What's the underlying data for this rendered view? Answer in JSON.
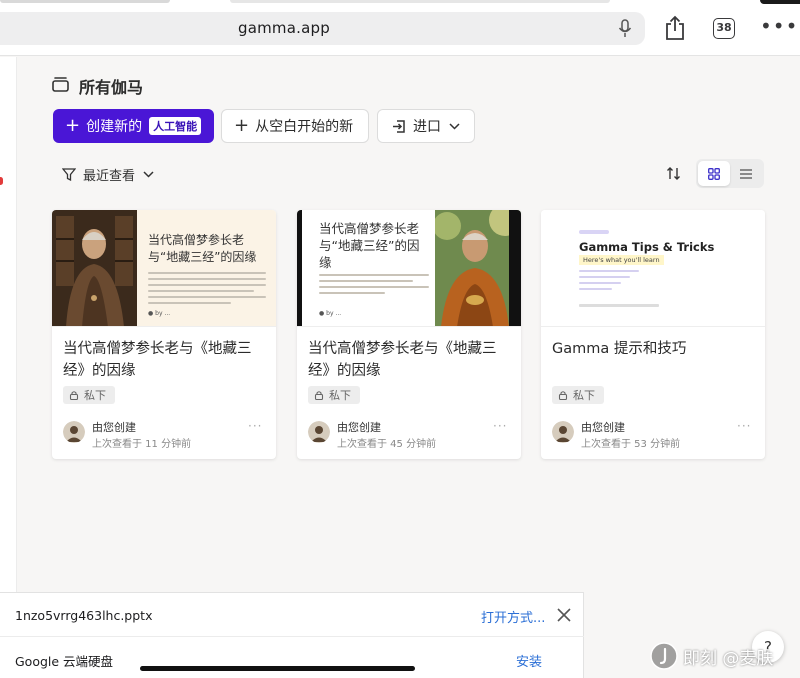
{
  "browser": {
    "url": "gamma.app",
    "tab_count": "38"
  },
  "header": {
    "title": "所有伽马"
  },
  "toolbar": {
    "create_label": "创建新的",
    "ai_badge": "人工智能",
    "blank_label": "从空白开始的新",
    "import_label": "进口"
  },
  "filter": {
    "label": "最近查看"
  },
  "cards": [
    {
      "title": "当代高僧梦参长老与《地藏三经》的因缘",
      "thumb_title": "当代高僧梦参长老与“地藏三经”的因缘",
      "visibility": "私下",
      "creator": "由您创建",
      "last_viewed": "上次查看于 11 分钟前"
    },
    {
      "title": "当代高僧梦参长老与《地藏三经》的因缘",
      "thumb_title": "当代高僧梦参长老与“地藏三经”的因缘",
      "visibility": "私下",
      "creator": "由您创建",
      "last_viewed": "上次查看于 45 分钟前"
    },
    {
      "title": "Gamma 提示和技巧",
      "thumb_title": "Gamma Tips & Tricks",
      "thumb_subtitle": "Here's what you'll learn",
      "visibility": "私下",
      "creator": "由您创建",
      "last_viewed": "上次查看于 53 分钟前"
    }
  ],
  "download": {
    "filename": "1nzo5vrrg463lhc.pptx",
    "open_with": "打开方式...",
    "app_name": "Google 云端硬盘",
    "install": "安装"
  },
  "help": "?",
  "watermark": "即刻 @麦肤",
  "colors": {
    "accent": "#4a16d6",
    "link": "#2b6fd6"
  }
}
